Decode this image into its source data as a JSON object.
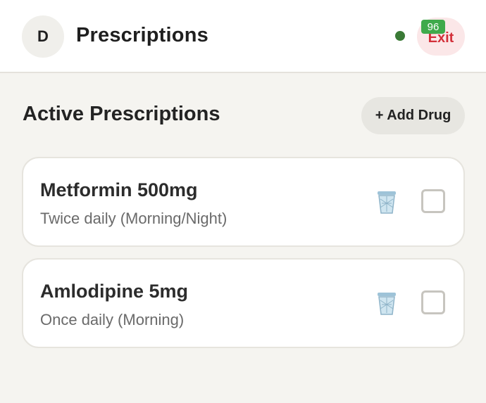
{
  "header": {
    "avatar_initial": "D",
    "title": "Prescriptions",
    "exit_label": "Exit",
    "battery_level": "96",
    "status_color": "#3a7a36",
    "exit_color": "#d3303a"
  },
  "section": {
    "title": "Active Prescriptions",
    "add_button_label": "+ Add Drug"
  },
  "prescriptions": [
    {
      "name": "Metformin 500mg",
      "schedule": "Twice daily (Morning/Night)",
      "icon": "trash-icon",
      "checked": false
    },
    {
      "name": "Amlodipine 5mg",
      "schedule": "Once daily (Morning)",
      "icon": "trash-icon",
      "checked": false
    }
  ]
}
